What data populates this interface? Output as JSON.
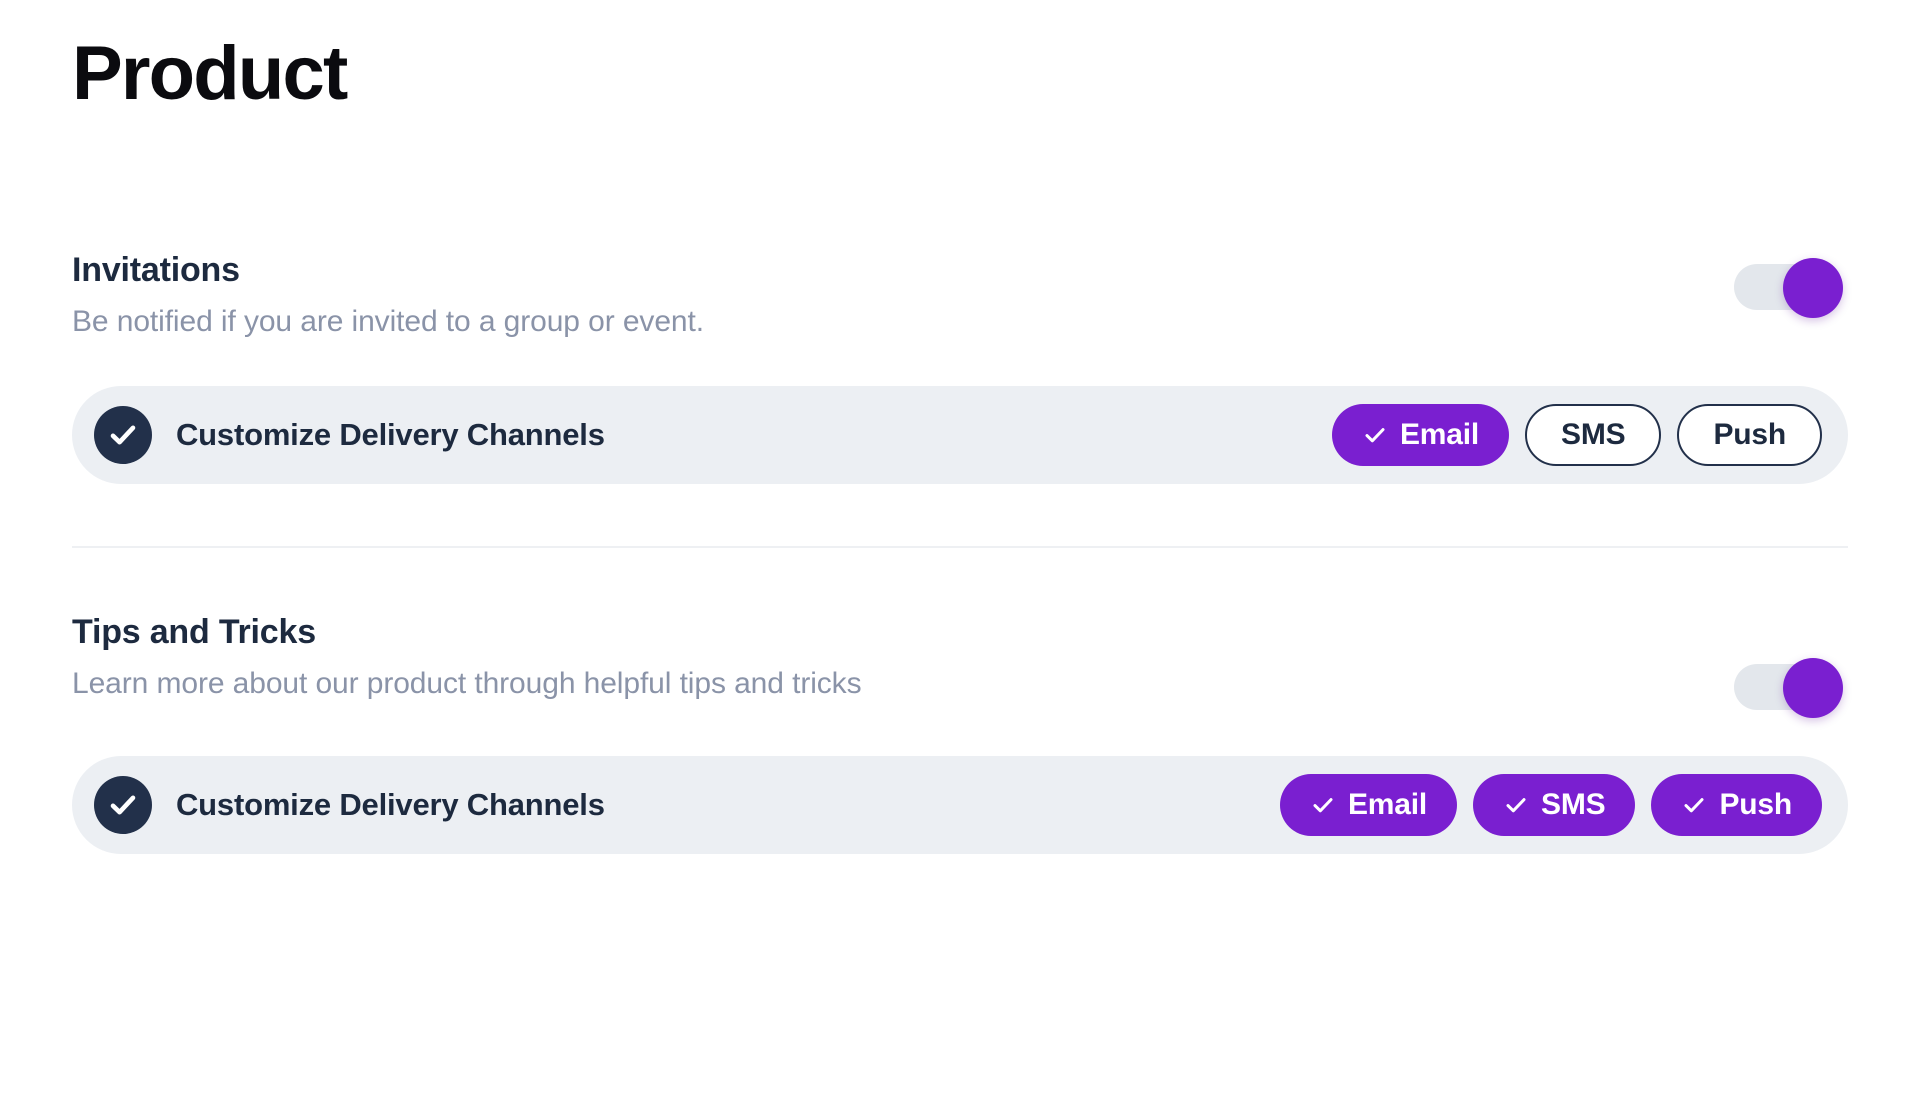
{
  "page": {
    "title": "Product"
  },
  "colors": {
    "accent_purple": "#7a1fd0",
    "heading_navy": "#1d2a3f",
    "muted_text": "#8a93a8",
    "row_background": "#eceff3",
    "toggle_track": "#e3e7ec",
    "check_circle": "#22304a",
    "divider": "#eef0f3",
    "title_black": "#0b0b0f"
  },
  "sections": [
    {
      "id": "invitations",
      "title": "Invitations",
      "description": "Be notified if you are invited to a group or event.",
      "toggle": {
        "name": "invitations-toggle",
        "state": "on",
        "label": "Invitations enabled"
      },
      "delivery": {
        "label": "Customize Delivery Channels",
        "enabled": true,
        "channels": [
          {
            "label": "Email",
            "selected": true
          },
          {
            "label": "SMS",
            "selected": false
          },
          {
            "label": "Push",
            "selected": false
          }
        ]
      }
    },
    {
      "id": "tips-and-tricks",
      "title": "Tips and Tricks",
      "description": "Learn more about our product through helpful tips and tricks",
      "toggle": {
        "name": "tips-and-tricks-toggle",
        "state": "on",
        "label": "Tips and Tricks enabled"
      },
      "delivery": {
        "label": "Customize Delivery Channels",
        "enabled": true,
        "channels": [
          {
            "label": "Email",
            "selected": true
          },
          {
            "label": "SMS",
            "selected": true
          },
          {
            "label": "Push",
            "selected": true
          }
        ]
      }
    }
  ],
  "icons": {
    "check_circle": "check-circle-icon",
    "chip_check": "check-icon"
  }
}
